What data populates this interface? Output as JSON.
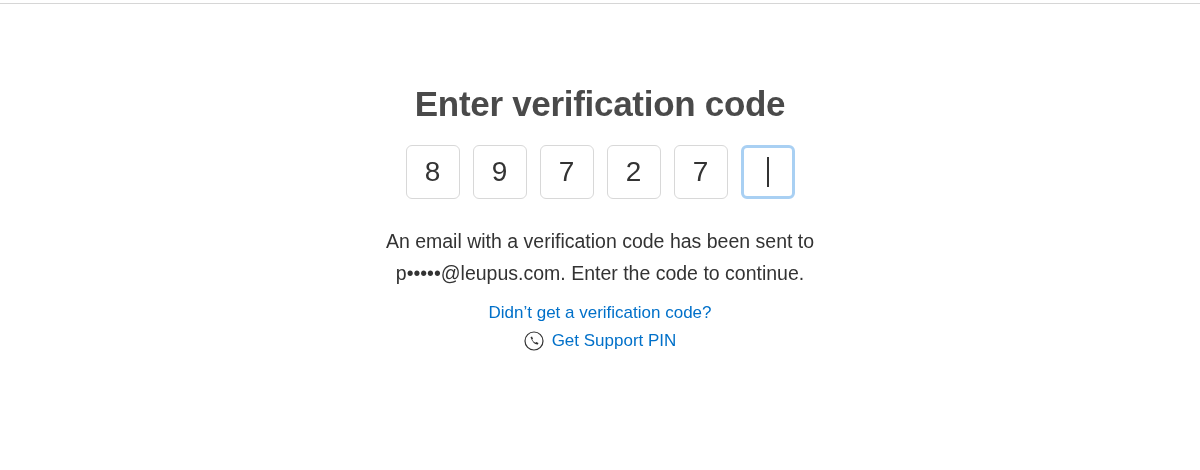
{
  "title": "Enter verification code",
  "code_digits": [
    {
      "value": "8",
      "focused": false
    },
    {
      "value": "9",
      "focused": false
    },
    {
      "value": "7",
      "focused": false
    },
    {
      "value": "2",
      "focused": false
    },
    {
      "value": "7",
      "focused": false
    },
    {
      "focused": true
    }
  ],
  "message": "An email with a verification code has been sent to p•••••@leupus.com. Enter the code to continue.",
  "resend_link": "Didn’t get a verification code?",
  "support_link": "Get Support PIN"
}
